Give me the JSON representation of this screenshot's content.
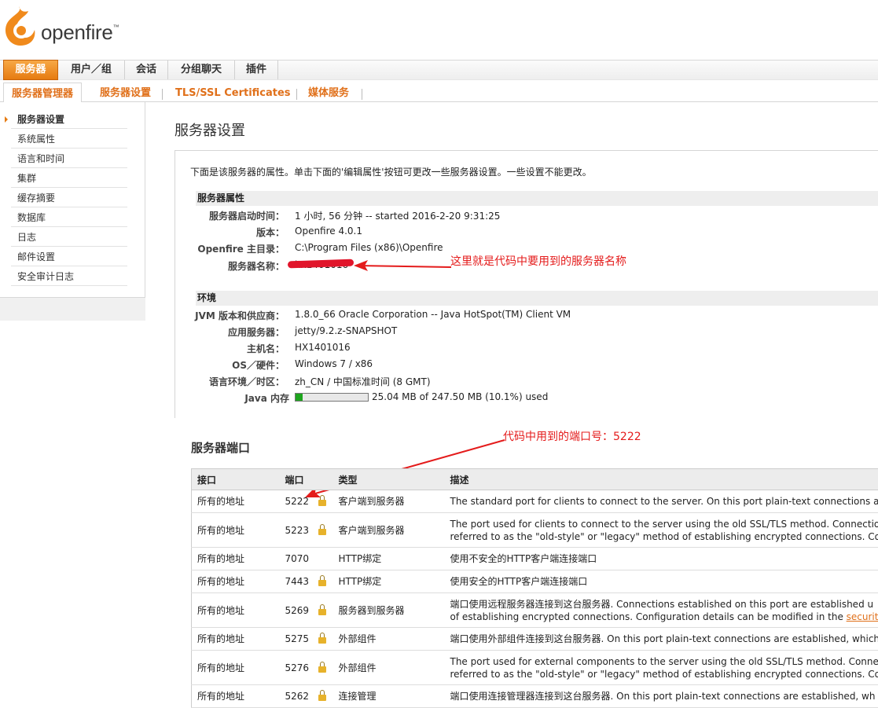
{
  "brand": {
    "name": "openfire",
    "tm": "™"
  },
  "main_tabs": [
    "服务器",
    "用户／组",
    "会话",
    "分组聊天",
    "插件"
  ],
  "sub_tabs": [
    "服务器管理器",
    "服务器设置",
    "TLS/SSL Certificates",
    "媒体服务"
  ],
  "sidebar": [
    "服务器设置",
    "系统属性",
    "语言和时间",
    "集群",
    "缓存摘要",
    "数据库",
    "日志",
    "邮件设置",
    "安全审计日志"
  ],
  "page": {
    "title": "服务器设置",
    "intro": "下面是该服务器的属性。单击下面的'编辑属性'按钮可更改一些服务器设置。一些设置不能更改。"
  },
  "server_props": {
    "header": "服务器属性",
    "rows": [
      {
        "label": "服务器启动时间：",
        "value": "1 小时, 56 分钟 -- started 2016-2-20 9:31:25"
      },
      {
        "label": "版本：",
        "value": "Openfire 4.0.1"
      },
      {
        "label": "Openfire 主目录：",
        "value": "C:\\Program Files (x86)\\Openfire"
      },
      {
        "label": "服务器名称：",
        "value": "hx1401016"
      }
    ]
  },
  "env": {
    "header": "环境",
    "rows": [
      {
        "label": "JVM 版本和供应商：",
        "value": "1.8.0_66 Oracle Corporation -- Java HotSpot(TM) Client VM"
      },
      {
        "label": "应用服务器：",
        "value": "jetty/9.2.z-SNAPSHOT"
      },
      {
        "label": "主机名：",
        "value": "HX1401016"
      },
      {
        "label": "OS／硬件：",
        "value": "Windows 7 / x86"
      },
      {
        "label": "语言环境／时区：",
        "value": "zh_CN / 中国标准时间 (8 GMT)"
      }
    ],
    "memory": {
      "label": "Java 内存",
      "text": "25.04 MB of 247.50 MB (10.1%) used",
      "fraction": 0.101
    }
  },
  "annotations": {
    "server_name": "这里就是代码中要用到的服务器名称",
    "port": "代码中用到的端口号：5222"
  },
  "ports": {
    "title": "服务器端口",
    "headers": [
      "接口",
      "端口",
      "类型",
      "描述"
    ],
    "rows": [
      {
        "iface": "所有的地址",
        "port": "5222",
        "secure": true,
        "type": "客户端到服务器",
        "desc": [
          "The standard port for clients to connect to the server. On this port plain-text connections are es"
        ]
      },
      {
        "iface": "所有的地址",
        "port": "5223",
        "secure": true,
        "type": "客户端到服务器",
        "desc": [
          "The port used for clients to connect to the server using the old SSL/TLS method. Connections",
          "referred to as the \"old-style\" or \"legacy\" method of establishing encrypted connections. Configu"
        ]
      },
      {
        "iface": "所有的地址",
        "port": "7070",
        "secure": false,
        "type": "HTTP绑定",
        "desc": [
          "使用不安全的HTTP客户端连接端口"
        ]
      },
      {
        "iface": "所有的地址",
        "port": "7443",
        "secure": true,
        "type": "HTTP绑定",
        "desc": [
          "使用安全的HTTP客户端连接端口"
        ]
      },
      {
        "iface": "所有的地址",
        "port": "5269",
        "secure": true,
        "type": "服务器到服务器",
        "desc": [
          "端口使用远程服务器连接到这台服务器. Connections established on this port are established u",
          "of establishing encrypted connections. Configuration details can be modified in the "
        ],
        "link": "security set"
      },
      {
        "iface": "所有的地址",
        "port": "5275",
        "secure": true,
        "type": "外部组件",
        "desc": [
          "端口使用外部组件连接到这台服务器. On this port plain-text connections are established, which"
        ]
      },
      {
        "iface": "所有的地址",
        "port": "5276",
        "secure": true,
        "type": "外部组件",
        "desc": [
          "The port used for external components to the server using the old SSL/TLS method. Connectio",
          "referred to as the \"old-style\" or \"legacy\" method of establishing encrypted connections. Configu"
        ]
      },
      {
        "iface": "所有的地址",
        "port": "5262",
        "secure": true,
        "type": "连接管理",
        "desc": [
          "端口使用连接管理器连接到这台服务器. On this port plain-text connections are established, wh"
        ]
      }
    ]
  }
}
